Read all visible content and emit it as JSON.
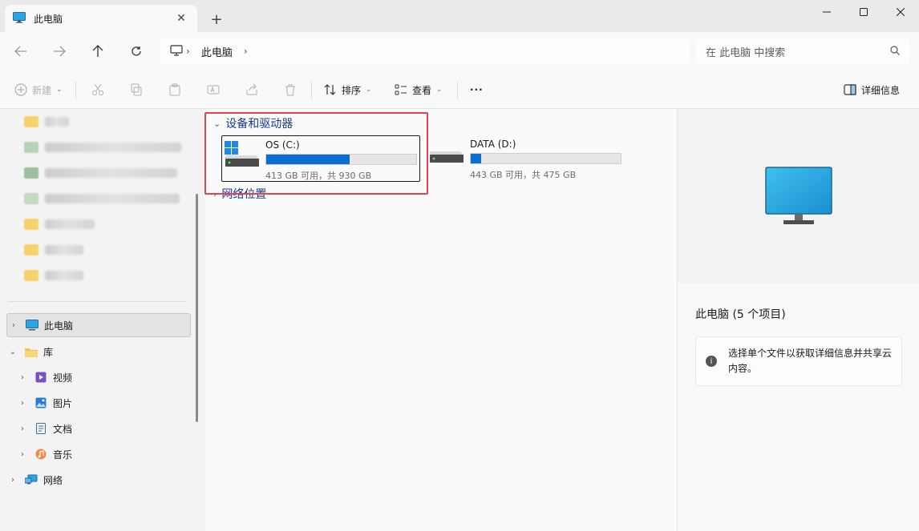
{
  "window": {
    "tab_title": "此电脑",
    "new_tab_label": "+"
  },
  "address": {
    "crumb": "此电脑",
    "search_placeholder": "在 此电脑 中搜索"
  },
  "toolbar": {
    "new_label": "新建",
    "sort_label": "排序",
    "view_label": "查看",
    "more_label": "···",
    "details_label": "详细信息"
  },
  "nav": {
    "this_pc": "此电脑",
    "library": "库",
    "video": "视频",
    "pictures": "图片",
    "documents": "文档",
    "music": "音乐",
    "network": "网络"
  },
  "content": {
    "group_devices": "设备和驱动器",
    "group_network": "网络位置",
    "drives": [
      {
        "name": "OS (C:)",
        "size_text": "413 GB 可用，共 930 GB",
        "used_fraction": 0.556
      },
      {
        "name": "DATA (D:)",
        "size_text": "443 GB 可用，共 475 GB",
        "used_fraction": 0.067
      }
    ]
  },
  "details": {
    "title": "此电脑 (5 个项目)",
    "info_text": "选择单个文件以获取详细信息并共享云内容。"
  },
  "colors": {
    "accent": "#0a6fd1",
    "highlight_border": "#e04450",
    "group_heading": "#1a3a8c"
  }
}
